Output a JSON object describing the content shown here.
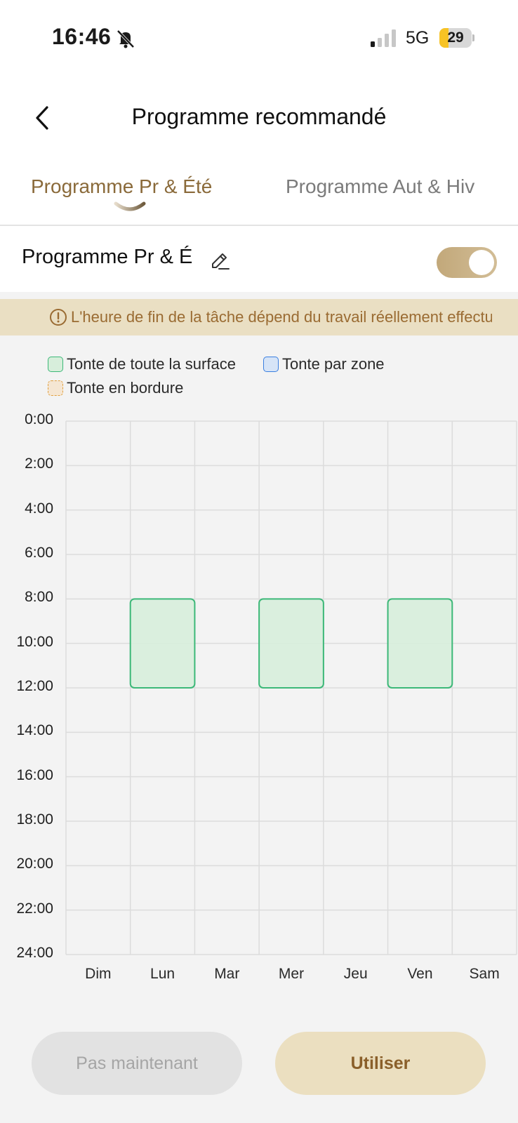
{
  "status_bar": {
    "time": "16:46",
    "network": "5G",
    "battery_level": "29",
    "battery_fraction": 0.29,
    "icons": [
      "bell-slash-icon",
      "cellular-signal-icon",
      "battery-icon"
    ]
  },
  "nav": {
    "back_icon": "chevron-left-icon",
    "title": "Programme recommandé"
  },
  "tabs": [
    {
      "label": "Programme Pr & Été",
      "active": true
    },
    {
      "label": "Programme Aut & Hiv",
      "active": false
    }
  ],
  "program": {
    "name": "Programme Pr & É",
    "edit_icon": "pencil-icon",
    "enabled": true
  },
  "notice": {
    "icon": "exclamation-circle-icon",
    "text": "L'heure de fin de la tâche dépend du travail réellement effectué"
  },
  "legend": [
    {
      "label": "Tonte de toute la surface",
      "fill": "#d7eedb",
      "stroke": "#3cb878"
    },
    {
      "label": "Tonte par zone",
      "fill": "#d6e4f7",
      "stroke": "#3a7fe0"
    },
    {
      "label": "Tonte en bordure",
      "fill": "#f5e6d3",
      "stroke": "#e0a040"
    }
  ],
  "chart_data": {
    "type": "heatmap",
    "days": [
      "Dim",
      "Lun",
      "Mar",
      "Mer",
      "Jeu",
      "Ven",
      "Sam"
    ],
    "hour_ticks": [
      "0:00",
      "2:00",
      "4:00",
      "6:00",
      "8:00",
      "10:00",
      "12:00",
      "14:00",
      "16:00",
      "18:00",
      "20:00",
      "22:00",
      "24:00"
    ],
    "y_range": [
      0,
      24
    ],
    "grid": true,
    "tasks": [
      {
        "day": "Lun",
        "start": 8,
        "end": 12,
        "type": "Tonte de toute la surface"
      },
      {
        "day": "Mer",
        "start": 8,
        "end": 12,
        "type": "Tonte de toute la surface"
      },
      {
        "day": "Ven",
        "start": 8,
        "end": 12,
        "type": "Tonte de toute la surface"
      }
    ]
  },
  "buttons": {
    "later": "Pas maintenant",
    "use": "Utiliser"
  },
  "colors": {
    "accent": "#8a6a3a",
    "toggle": "#c8b088",
    "notice_bg": "#eadfc3",
    "notice_text": "#9a6b32",
    "grid": "#dcdcdc"
  }
}
